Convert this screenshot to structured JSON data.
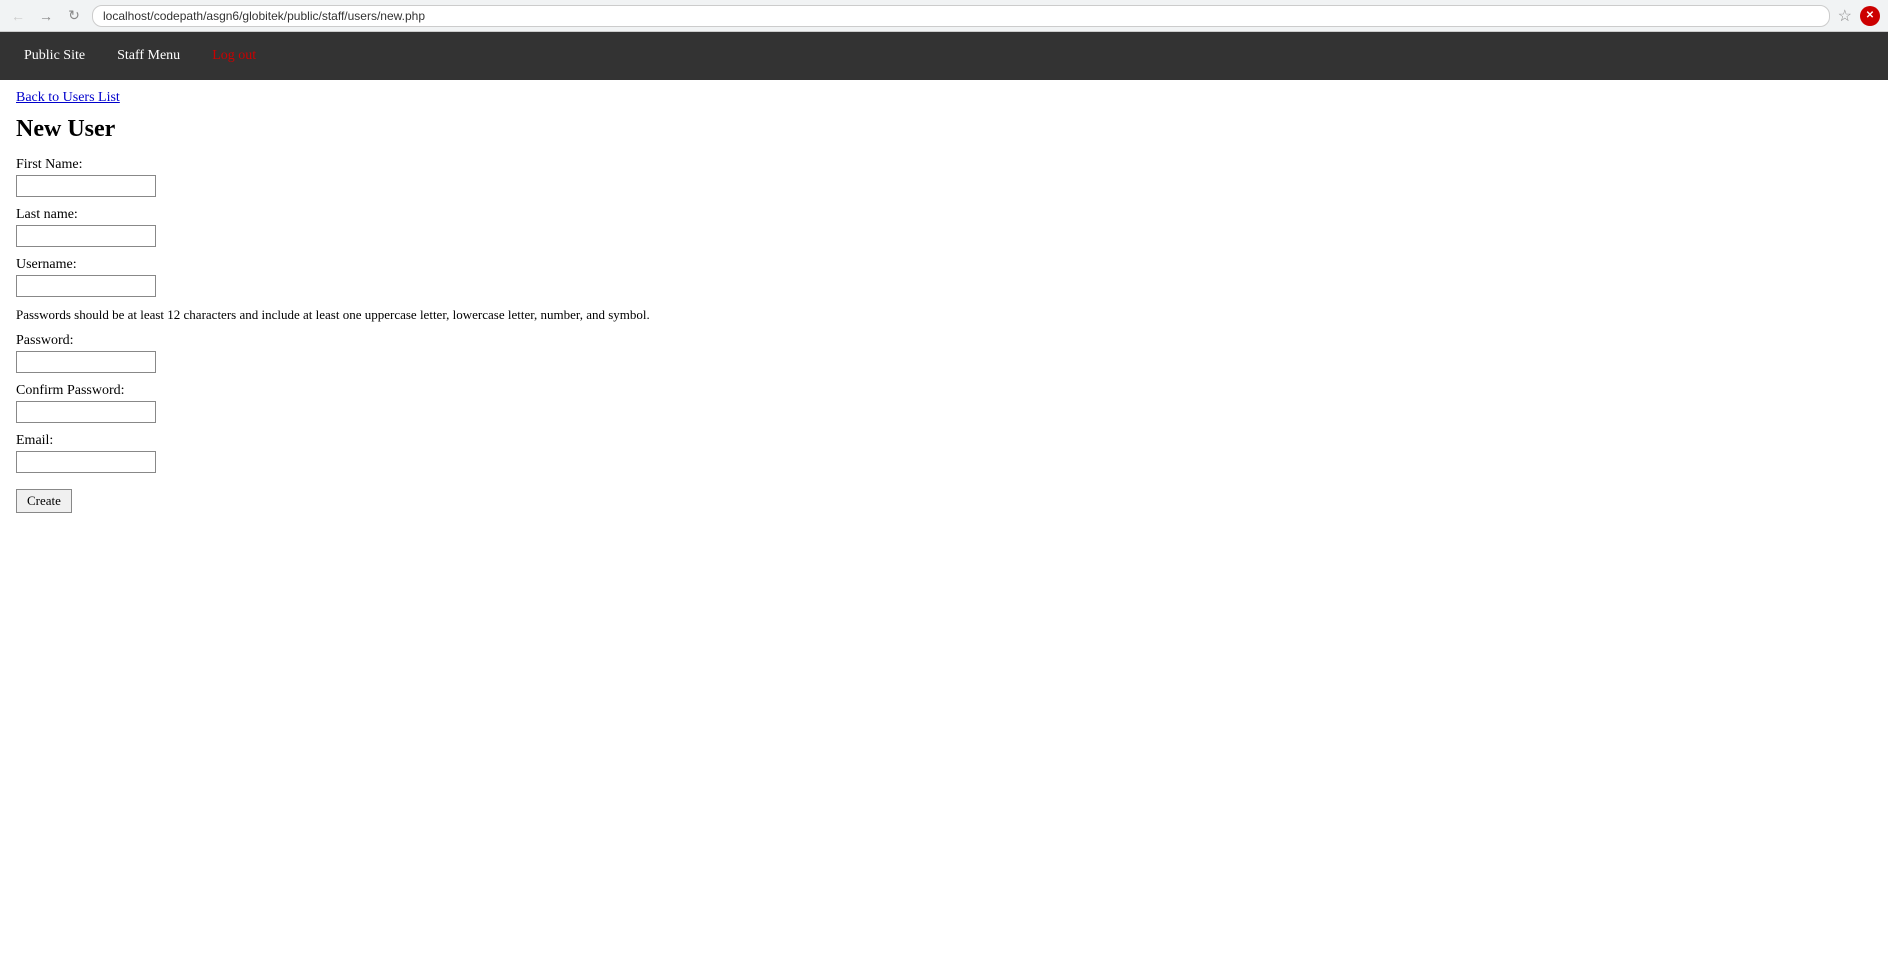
{
  "browser": {
    "url": "localhost/codepath/asgn6/globitek/public/staff/users/new.php"
  },
  "navbar": {
    "public_site_label": "Public Site",
    "staff_menu_label": "Staff Menu",
    "logout_label": "Log out"
  },
  "page": {
    "back_link_label": "Back to Users List",
    "title": "New User",
    "form": {
      "first_name_label": "First Name:",
      "last_name_label": "Last name:",
      "username_label": "Username:",
      "password_hint": "Passwords should be at least 12 characters and include at least one uppercase letter, lowercase letter, number, and symbol.",
      "password_label": "Password:",
      "confirm_password_label": "Confirm Password:",
      "email_label": "Email:",
      "create_button_label": "Create"
    }
  }
}
